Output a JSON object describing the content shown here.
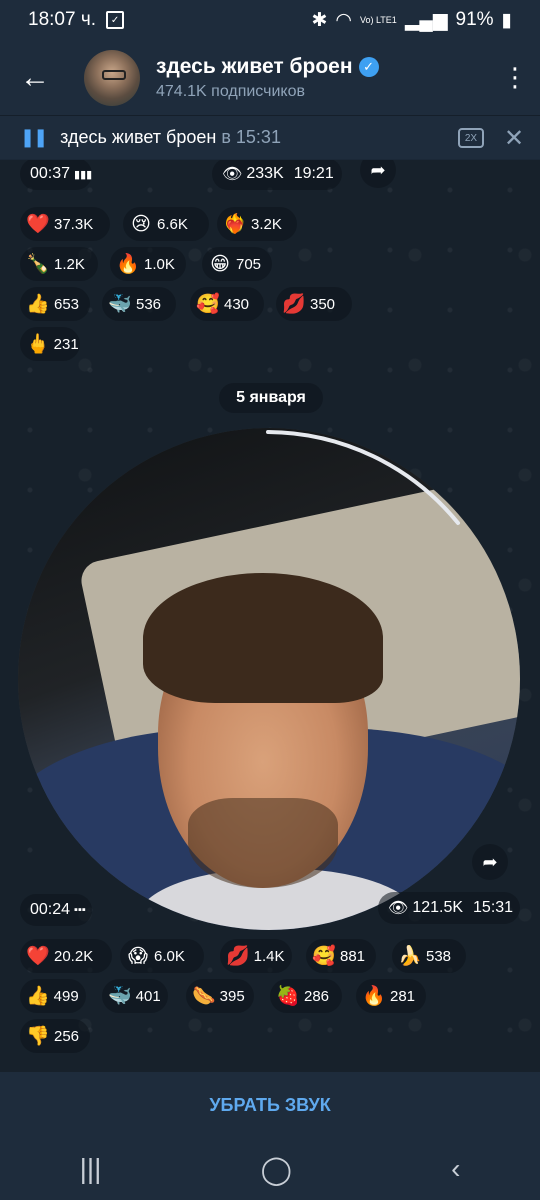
{
  "status": {
    "time": "18:07 ч.",
    "network": "Vo) LTE1",
    "battery": "91%"
  },
  "header": {
    "title": "здесь живет броен",
    "subtitle": "474.1K подписчиков"
  },
  "player": {
    "title": "здесь живет броен",
    "time": "в 15:31",
    "speed": "2X"
  },
  "msg1": {
    "duration": "00:37",
    "views": "233K",
    "time": "19:21",
    "reactions": [
      {
        "emoji": "❤️",
        "count": "37.3K"
      },
      {
        "emoji": "😢",
        "count": "6.6K"
      },
      {
        "emoji": "❤️‍🔥",
        "count": "3.2K"
      },
      {
        "emoji": "🍾",
        "count": "1.2K"
      },
      {
        "emoji": "🔥",
        "count": "1.0K"
      },
      {
        "emoji": "😁",
        "count": "705"
      },
      {
        "emoji": "👍",
        "count": "653"
      },
      {
        "emoji": "🐳",
        "count": "536"
      },
      {
        "emoji": "🥰",
        "count": "430"
      },
      {
        "emoji": "💋",
        "count": "350"
      },
      {
        "emoji": "🖕",
        "count": "231"
      }
    ]
  },
  "date_label": "5 января",
  "msg2": {
    "duration": "00:24",
    "views": "121.5K",
    "time": "15:31",
    "reactions": [
      {
        "emoji": "❤️",
        "count": "20.2K"
      },
      {
        "emoji": "😱",
        "count": "6.0K"
      },
      {
        "emoji": "💋",
        "count": "1.4K"
      },
      {
        "emoji": "🥰",
        "count": "881"
      },
      {
        "emoji": "🍌",
        "count": "538"
      },
      {
        "emoji": "👍",
        "count": "499"
      },
      {
        "emoji": "🐳",
        "count": "401"
      },
      {
        "emoji": "🌭",
        "count": "395"
      },
      {
        "emoji": "🍓",
        "count": "286"
      },
      {
        "emoji": "🔥",
        "count": "281"
      },
      {
        "emoji": "👎",
        "count": "256"
      }
    ]
  },
  "bottom_button": "УБРАТЬ ЗВУК"
}
